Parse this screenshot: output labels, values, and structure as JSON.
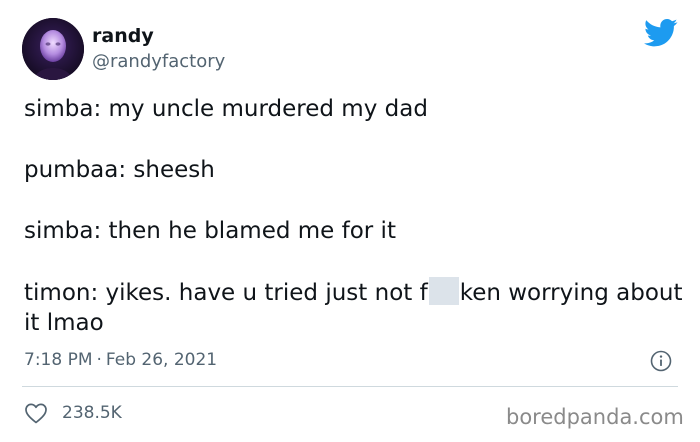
{
  "author": {
    "display_name": "randy",
    "handle": "@randyfactory",
    "avatar_icon": "avatar-image"
  },
  "tweet": {
    "lines": [
      "simba: my uncle murdered my dad",
      "pumbaa: sheesh",
      "simba: then he blamed me for it"
    ],
    "last_line_before": "timon: yikes. have u tried just not f",
    "last_line_after": "ken worrying about it lmao",
    "timestamp_time": "7:18 PM",
    "timestamp_sep": "·",
    "timestamp_date": "Feb 26, 2021"
  },
  "engagement": {
    "like_count": "238.5K"
  },
  "watermark": "boredpanda.com",
  "icons": {
    "brand": "twitter-bird-icon",
    "info": "info-icon",
    "like": "heart-icon"
  },
  "colors": {
    "twitter_blue": "#1d9bf0",
    "secondary_text": "#536471",
    "censor": "#dce3ea",
    "divider": "#cfd9de"
  }
}
